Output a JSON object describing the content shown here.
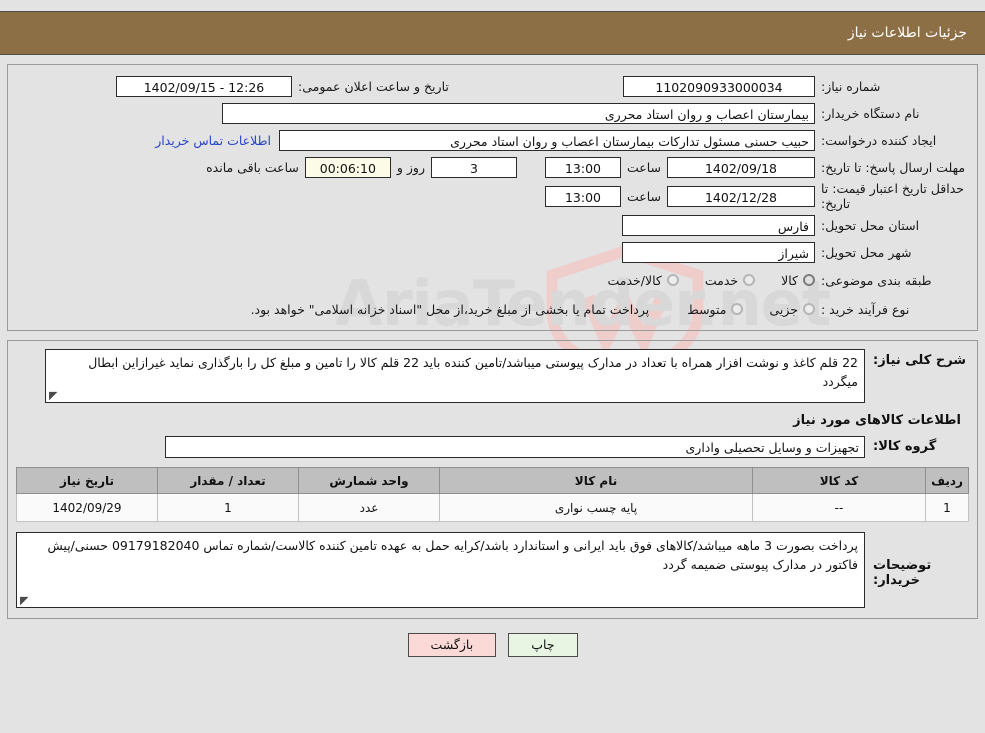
{
  "header": {
    "title": "جزئیات اطلاعات نیاز"
  },
  "info": {
    "need_number_label": "شماره نیاز:",
    "need_number_value": "1102090933000034",
    "announce_label": "تاریخ و ساعت اعلان عمومی:",
    "announce_value": "12:26 - 1402/09/15",
    "buyer_org_label": "نام دستگاه خریدار:",
    "buyer_org_value": "بیمارستان اعصاب و روان استاد محرری",
    "requester_label": "ایجاد کننده درخواست:",
    "requester_value": "حبیب حسنی مسئول تدارکات بیمارستان اعصاب و روان استاد محرری",
    "contact_link": "اطلاعات تماس خریدار",
    "deadline_label": "مهلت ارسال پاسخ: تا تاریخ:",
    "deadline_date": "1402/09/18",
    "deadline_hour_label": "ساعت",
    "deadline_hour": "13:00",
    "days_value": "3",
    "days_label": "روز و",
    "countdown_value": "00:06:10",
    "countdown_label": "ساعت باقی مانده",
    "price_validity_label": "حداقل تاریخ اعتبار قیمت: تا تاریخ:",
    "price_validity_date": "1402/12/28",
    "price_validity_hour_label": "ساعت",
    "price_validity_hour": "13:00",
    "province_label": "استان محل تحویل:",
    "province_value": "فارس",
    "city_label": "شهر محل تحویل:",
    "city_value": "شیراز",
    "category_label": "طبقه بندی موضوعی:",
    "category_options": [
      "کالا",
      "خدمت",
      "کالا/خدمت"
    ],
    "category_selected": "کالا",
    "process_label": "نوع فرآیند خرید :",
    "process_options": [
      "جزیی",
      "متوسط"
    ],
    "process_selected": "جزیی",
    "process_note": "پرداخت تمام یا بخشی از مبلغ خرید،از محل \"اسناد خزانه اسلامی\" خواهد بود."
  },
  "detail": {
    "need_desc_label": "شرح کلی نیاز:",
    "need_desc_value": "22 قلم کاغذ و نوشت افزار همراه با تعداد در مدارک پیوستی میباشد/تامین کننده باید 22 قلم کالا را تامین و مبلغ کل را بارگذاری نماید غیرازاین ابطال میگردد",
    "section_title": "اطلاعات کالاهای مورد نیاز",
    "goods_group_label": "گروه کالا:",
    "goods_group_value": "تجهیزات و وسایل تحصیلی واداری",
    "table": {
      "columns": [
        "ردیف",
        "کد کالا",
        "نام کالا",
        "واحد شمارش",
        "تعداد / مقدار",
        "تاریخ نیاز"
      ],
      "rows": [
        {
          "row_no": "1",
          "item_code": "--",
          "item_name": "پایه چسب نواری",
          "unit": "عدد",
          "quantity": "1",
          "need_date": "1402/09/29"
        }
      ]
    },
    "buyer_notes_label": "توضیحات خریدار:",
    "buyer_notes_value": "پرداخت بصورت 3 ماهه میباشد/کالاهای فوق باید ایرانی و استاندارد باشد/کرایه حمل به عهده تامین کننده کالاست/شماره تماس 09179182040 حسنی/پیش فاکتور در مدارک پیوستی ضمیمه گردد"
  },
  "buttons": {
    "print": "چاپ",
    "back": "بازگشت"
  },
  "watermark": {
    "text": "AriaTender.net"
  },
  "colors": {
    "header_bg": "#8c6f45",
    "page_bg": "#e3e3e3",
    "link": "#2a44c8",
    "countdown_bg": "#fbfbe8",
    "print_btn": "#e8f5e2",
    "back_btn": "#fbd9d6",
    "table_header_bg": "#bfbfbf"
  }
}
